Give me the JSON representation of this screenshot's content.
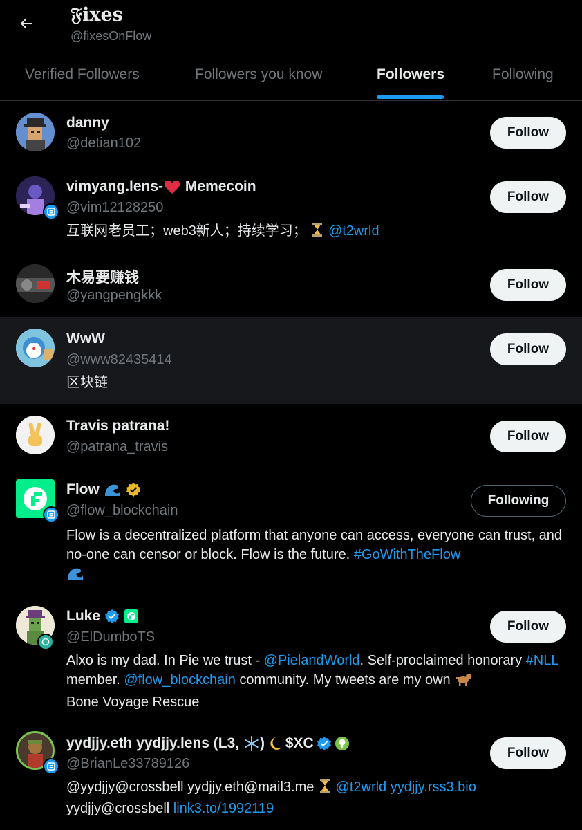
{
  "header": {
    "title": "𝔉ixes",
    "handle": "@fixesOnFlow"
  },
  "tabs": [
    {
      "label": "Verified Followers"
    },
    {
      "label": "Followers you know"
    },
    {
      "label": "Followers"
    },
    {
      "label": "Following"
    }
  ],
  "active_tab": "Followers",
  "colors": {
    "background": "#000000",
    "accent": "#1d9bf0",
    "muted": "#71767b",
    "gold": "#e9b72b"
  },
  "users": [
    {
      "name": "danny",
      "handle": "@detian102",
      "button": "Follow"
    },
    {
      "name": "vimyang.lens-",
      "name_suffix": " Memecoin",
      "handle": "@vim12128250",
      "bio_text": "互联网老员工；web3新人；持续学习；",
      "bio_link": "@t2wrld",
      "button": "Follow"
    },
    {
      "name": "木易要赚钱",
      "handle": "@yangpengkkk",
      "button": "Follow"
    },
    {
      "name": "WwW",
      "handle": "@www82435414",
      "bio_text": "区块链",
      "button": "Follow"
    },
    {
      "name": "Travis patrana!",
      "handle": "@patrana_travis",
      "button": "Follow"
    },
    {
      "name": "Flow",
      "handle": "@flow_blockchain",
      "bio_text": "Flow is a decentralized platform that anyone can access, everyone can trust, and no-one can censor or block. Flow is the future.",
      "bio_link": "#GoWithTheFlow",
      "button": "Following"
    },
    {
      "name": "Luke",
      "handle": "@ElDumboTS",
      "bio_1": "Alxo is my dad. In Pie we trust - ",
      "bio_link_1": "@PielandWorld",
      "bio_2": ". Self-proclaimed honorary ",
      "bio_link_2": "#NLL",
      "bio_3": " member. ",
      "bio_link_3": "@flow_blockchain",
      "bio_4": " community. My tweets are my own ",
      "bio_5": "Bone Voyage Rescue",
      "button": "Follow"
    },
    {
      "name": "yydjjy.eth yydjjy.lens (L3, ",
      "name_mid": ") ",
      "name_end": "$XC",
      "handle": "@BrianLe33789126",
      "bio_1": "@yydjjy@crossbell yydjjy.eth@mail3.me ",
      "bio_link_1": "@t2wrld yydjjy.rss3.bio",
      "bio_2": "yydjjy@crossbell ",
      "bio_link_2": "link3.to/1992119",
      "button": "Follow"
    }
  ]
}
